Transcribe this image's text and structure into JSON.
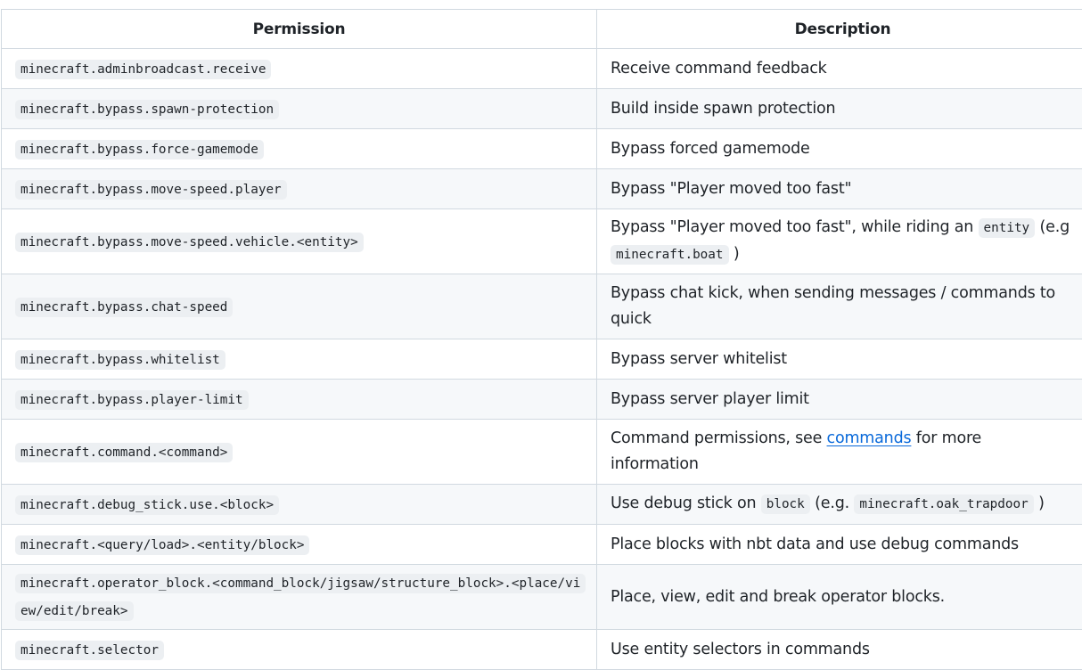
{
  "table": {
    "headers": [
      "Permission",
      "Description"
    ],
    "rows": [
      {
        "permission": "minecraft.adminbroadcast.receive",
        "description": "Receive command feedback"
      },
      {
        "permission": "minecraft.bypass.spawn-protection",
        "description": "Build inside spawn protection"
      },
      {
        "permission": "minecraft.bypass.force-gamemode",
        "description": "Bypass forced gamemode"
      },
      {
        "permission": "minecraft.bypass.move-speed.player",
        "description": "Bypass \"Player moved too fast\""
      },
      {
        "permission": "minecraft.bypass.move-speed.vehicle.<entity>",
        "description_parts": [
          "Bypass \"Player moved too fast\", while riding an ",
          "entity",
          " (e.g ",
          "minecraft.boat",
          " )"
        ]
      },
      {
        "permission": "minecraft.bypass.chat-speed",
        "description": "Bypass chat kick, when sending messages / commands to quick"
      },
      {
        "permission": "minecraft.bypass.whitelist",
        "description": "Bypass server whitelist"
      },
      {
        "permission": "minecraft.bypass.player-limit",
        "description": "Bypass server player limit"
      },
      {
        "permission": "minecraft.command.<command>",
        "description_parts": [
          "Command permissions, see ",
          "commands",
          " for more information"
        ]
      },
      {
        "permission": "minecraft.debug_stick.use.<block>",
        "description_parts": [
          "Use debug stick on ",
          "block",
          " (e.g. ",
          "minecraft.oak_trapdoor",
          " )"
        ]
      },
      {
        "permission": "minecraft.<query/load>.<entity/block>",
        "description": "Place blocks with nbt data and use debug commands"
      },
      {
        "permission": "minecraft.operator_block.<command_block/jigsaw/structure_block>.<place/view/edit/break>",
        "description": "Place, view, edit and break operator blocks."
      },
      {
        "permission": "minecraft.selector",
        "description": "Use entity selectors in commands"
      }
    ]
  },
  "colors": {
    "link": "#0969da",
    "border": "#d1d9e0",
    "stripe": "#f6f8fa",
    "code_bg": "#eceff2"
  }
}
